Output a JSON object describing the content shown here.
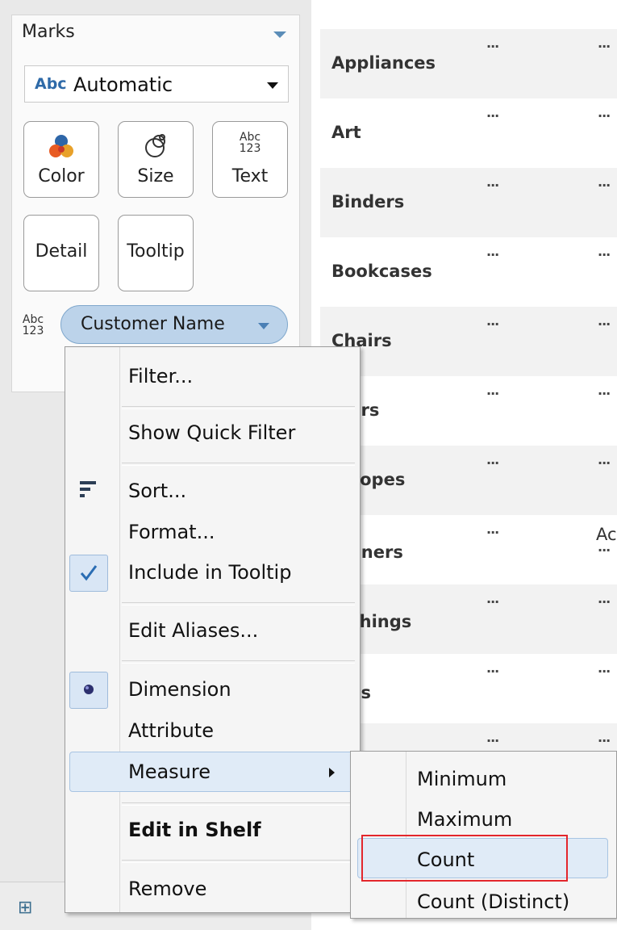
{
  "marks": {
    "title": "Marks",
    "mark_type_icon": "Abc",
    "mark_type": "Automatic",
    "buttons": {
      "color": "Color",
      "size": "Size",
      "text": "Text",
      "detail": "Detail",
      "tooltip": "Tooltip"
    },
    "text_icon": [
      "Abc",
      "123"
    ],
    "field_type_icon": [
      "Abc",
      "123"
    ],
    "field_pill": "Customer Name"
  },
  "table": {
    "categories": [
      "Appliances",
      "Art",
      "Binders",
      "Bookcases",
      "Chairs",
      "piers",
      "velopes",
      "steners",
      "nishings",
      "bels"
    ],
    "cell_text": "...",
    "partial_cell": "Ac"
  },
  "context_menu": {
    "items": {
      "filter": "Filter...",
      "show_quick_filter": "Show Quick Filter",
      "sort": "Sort...",
      "format": "Format...",
      "include_in_tooltip": "Include in Tooltip",
      "edit_aliases": "Edit Aliases...",
      "dimension": "Dimension",
      "attribute": "Attribute",
      "measure": "Measure",
      "edit_in_shelf": "Edit in Shelf",
      "remove": "Remove"
    },
    "checked": "Include in Tooltip",
    "selected_role": "Dimension",
    "highlighted": "Measure"
  },
  "measure_submenu": {
    "items": [
      "Minimum",
      "Maximum",
      "Count",
      "Count (Distinct)"
    ],
    "highlighted": "Count"
  },
  "colors": {
    "pill_fill": "#bcd3ea",
    "highlight": "#e0ebf7",
    "callout_box": "#e3262c",
    "check": "#2a6db3"
  }
}
